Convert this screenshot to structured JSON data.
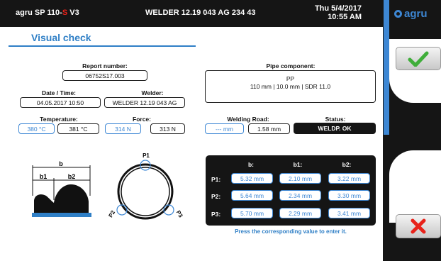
{
  "header": {
    "model_prefix": "agru SP 110-",
    "model_s": "S",
    "model_suffix": " V3",
    "welder": "WELDER 12.19 043 AG 234 43",
    "date": "Thu 5/4/2017",
    "time": "10:55 AM"
  },
  "brand": {
    "logo_text": "agru"
  },
  "title": "Visual check",
  "report": {
    "label": "Report number:",
    "value": "06752S17.003"
  },
  "datetime": {
    "label": "Date / Time:",
    "value": "04.05.2017  10:50"
  },
  "welder": {
    "label": "Welder:",
    "value": "WELDER 12.19 043 AG"
  },
  "temperature": {
    "label": "Temperature:",
    "set": "380 °C",
    "actual": "381 °C"
  },
  "force": {
    "label": "Force:",
    "set": "314 N",
    "actual": "313 N"
  },
  "pipe": {
    "label": "Pipe component:",
    "material": "PP",
    "spec": "110 mm | 10.0 mm | SDR 11.0"
  },
  "welding_road": {
    "label": "Welding Road:",
    "set": "--- mm",
    "actual": "1.58 mm"
  },
  "status": {
    "label": "Status:",
    "value": "WELDP. OK"
  },
  "diagram": {
    "b": "b",
    "b1": "b1",
    "b2": "b2",
    "p1": "P1",
    "p2": "P2",
    "p3": "P3"
  },
  "measurements": {
    "headers": [
      "b:",
      "b1:",
      "b2:"
    ],
    "rows": [
      {
        "label": "P1:",
        "values": [
          "5.32 mm",
          "2.10 mm",
          "3.22 mm"
        ]
      },
      {
        "label": "P2:",
        "values": [
          "5.64 mm",
          "2.34 mm",
          "3.30 mm"
        ]
      },
      {
        "label": "P3:",
        "values": [
          "5.70 mm",
          "2.29 mm",
          "3.41 mm"
        ]
      }
    ],
    "hint": "Press the corresponding value to enter it."
  },
  "colors": {
    "accent": "#2f7fc6",
    "ok_green": "#3fae3a",
    "cancel_red": "#e8221a",
    "dark": "#151515"
  }
}
